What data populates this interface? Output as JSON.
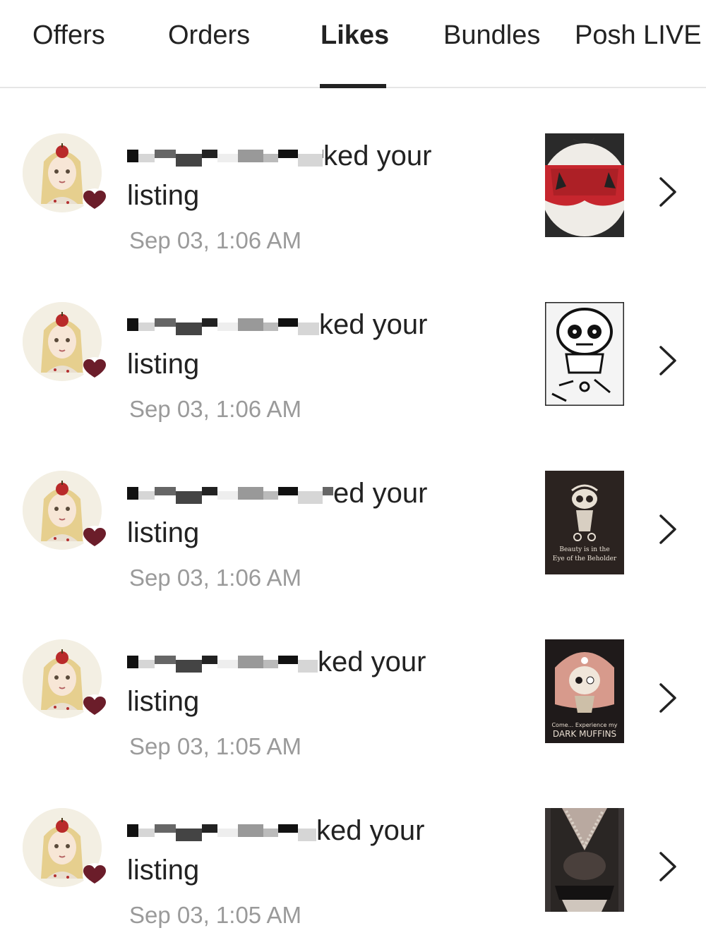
{
  "tabs": [
    {
      "label": "Offers",
      "active": false
    },
    {
      "label": "Orders",
      "active": false
    },
    {
      "label": "Likes",
      "active": true
    },
    {
      "label": "Bundles",
      "active": false
    },
    {
      "label": "Posh LIVE",
      "active": false
    }
  ],
  "notifications": [
    {
      "message_suffix": "ked your",
      "message_line2": "listing",
      "time": "Sep 03, 1:06 AM",
      "thumb_icon": "red-shorts-listing-image"
    },
    {
      "message_suffix": "ked your",
      "message_line2": "listing",
      "time": "Sep 03, 1:06 AM",
      "thumb_icon": "skull-doll-shirt-listing-image"
    },
    {
      "message_suffix": "ed your",
      "message_line2": "listing",
      "time": "Sep 03, 1:06 AM",
      "thumb_icon": "black-beholder-shirt-listing-image",
      "thumb_text": [
        "Beauty is in the",
        "Eye of the Beholder"
      ]
    },
    {
      "message_suffix": "ked your",
      "message_line2": "listing",
      "time": "Sep 03, 1:05 AM",
      "thumb_icon": "dark-muffins-shirt-listing-image",
      "thumb_text": [
        "Come... Experience my",
        "DARK MUFFINS"
      ]
    },
    {
      "message_suffix": "ked your",
      "message_line2": "listing",
      "time": "Sep 03, 1:05 AM",
      "thumb_icon": "black-lace-top-listing-image"
    }
  ],
  "colors": {
    "heart": "#6b1d2a",
    "text": "#222222",
    "muted": "#9a9a9a",
    "divider": "#e6e6e6"
  }
}
